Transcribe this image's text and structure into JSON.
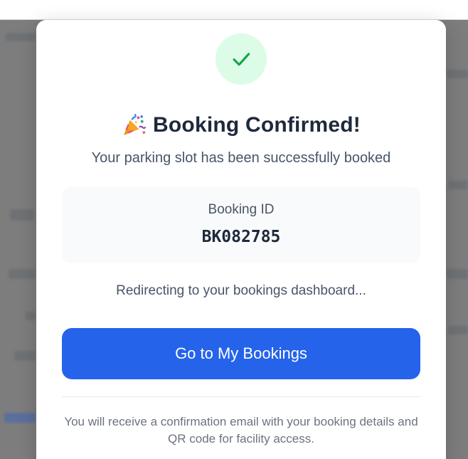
{
  "modal": {
    "title": "Booking Confirmed!",
    "title_icon": "party-popper-icon",
    "status_icon": "check-icon",
    "subtitle": "Your parking slot has been successfully booked",
    "booking": {
      "label": "Booking ID",
      "id": "BK082785"
    },
    "redirect_message": "Redirecting to your bookings dashboard...",
    "primary_button_label": "Go to My Bookings",
    "footer_note": "You will receive a confirmation email with your booking details and QR code for facility access."
  },
  "colors": {
    "accent": "#2563eb",
    "success": "#16a34a",
    "success_bg": "#dcfce7",
    "overlay": "#7d7d7d"
  }
}
